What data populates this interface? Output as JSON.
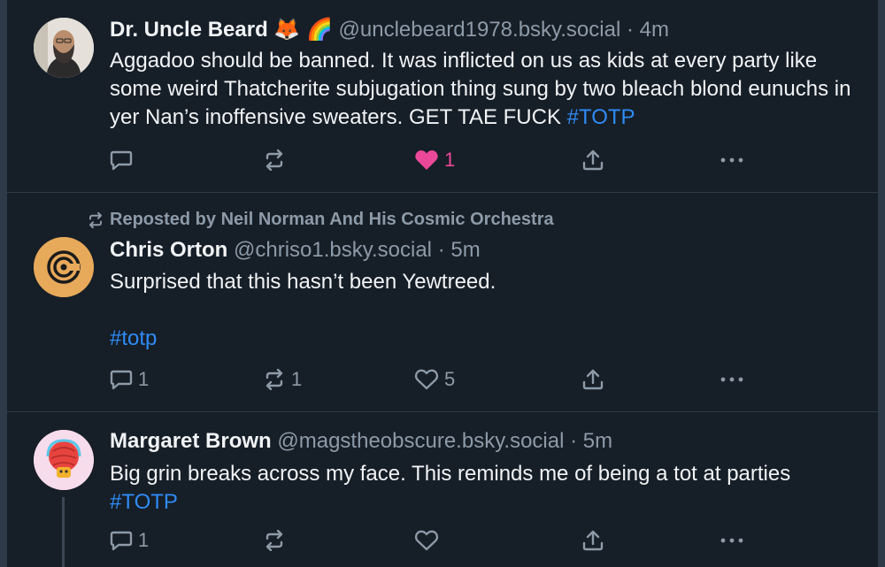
{
  "posts": [
    {
      "author_name": "Dr. Uncle Beard",
      "emoji": "🦊 🌈",
      "handle": "@unclebeard1978.bsky.social",
      "sep": "·",
      "time": "4m",
      "text": "Aggadoo should be banned. It was inflicted on us as kids at every party like some weird Thatcherite subjugation thing sung by two bleach blond eunuchs in yer Nan’s inoffensive sweaters. GET TAE FUCK ",
      "hashtag": "#TOTP",
      "reply_count": "",
      "repost_count": "",
      "like_count": "1",
      "liked": true
    },
    {
      "repost_label": "Reposted by Neil Norman And His Cosmic Orchestra",
      "author_name": "Chris Orton",
      "handle": "@chriso1.bsky.social",
      "sep": "·",
      "time": "5m",
      "text": "Surprised that this hasn’t been Yewtreed.",
      "hashtag": "#totp",
      "reply_count": "1",
      "repost_count": "1",
      "like_count": "5",
      "liked": false
    },
    {
      "author_name": "Margaret Brown",
      "handle": "@magstheobscure.bsky.social",
      "sep": "·",
      "time": "5m",
      "text": "Big grin breaks across my face. This reminds me of being a tot at parties",
      "hashtag": "#TOTP",
      "reply_count": "1",
      "repost_count": "",
      "like_count": "",
      "liked": false
    }
  ],
  "icons": {
    "reply": "reply-icon",
    "repost": "repost-icon",
    "like": "heart-icon",
    "share": "share-icon",
    "more": "more-icon"
  },
  "colors": {
    "background": "#161e27",
    "link": "#2f8bf5",
    "like": "#ec4899",
    "muted": "#8d9aa8"
  }
}
